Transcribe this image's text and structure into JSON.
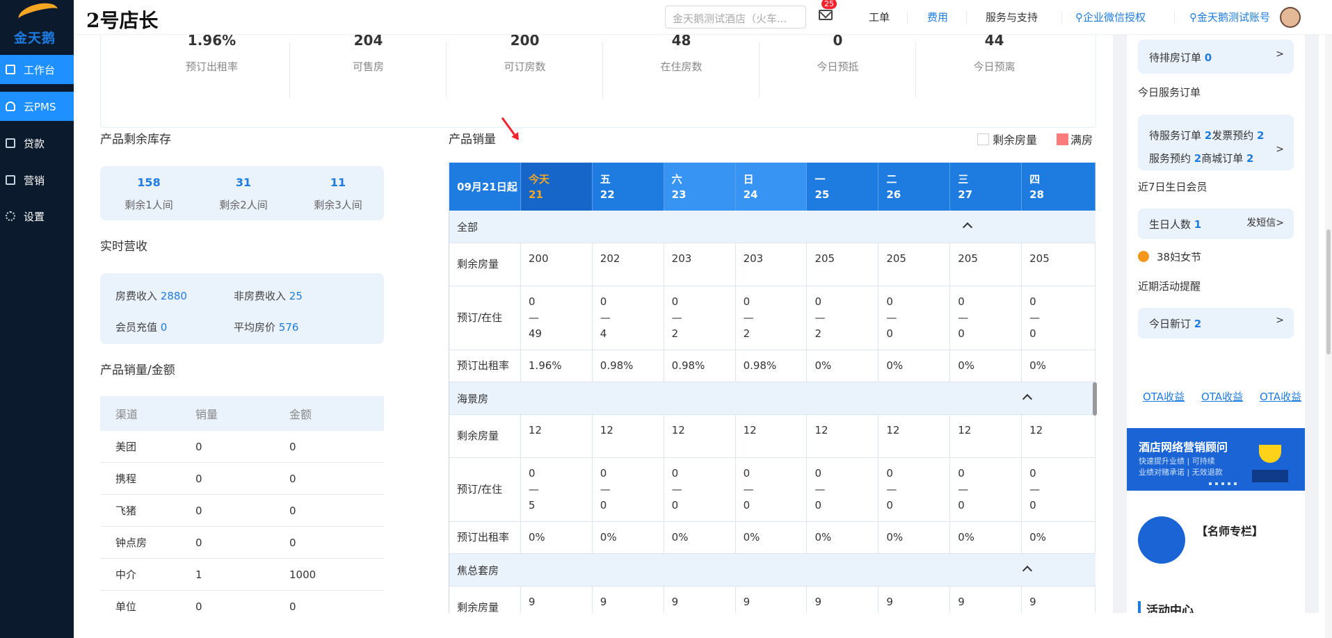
{
  "sidebar": {
    "logo_text": "金天鹅",
    "items": [
      {
        "label": "工作台",
        "icon": "workbench-icon"
      },
      {
        "label": "云PMS",
        "icon": "cloud-icon"
      },
      {
        "label": "贷款",
        "icon": "loan-icon"
      },
      {
        "label": "营销",
        "icon": "marketing-icon"
      },
      {
        "label": "设置",
        "icon": "gear-icon"
      }
    ]
  },
  "topbar": {
    "brand": "2号店长",
    "hotel_select": "金天鹅测试酒店（火车...",
    "mail_badge": "25",
    "links": [
      "工单",
      "费用",
      "服务与支持",
      "企业微信授权",
      "金天鹅测试账号"
    ]
  },
  "stats": [
    {
      "value": "1.96%",
      "label": "预订出租率"
    },
    {
      "value": "204",
      "label": "可售房"
    },
    {
      "value": "200",
      "label": "可订房数"
    },
    {
      "value": "48",
      "label": "在住房数"
    },
    {
      "value": "0",
      "label": "今日预抵"
    },
    {
      "value": "44",
      "label": "今日预离"
    }
  ],
  "inventory": {
    "title": "产品剩余库存",
    "items": [
      {
        "value": "158",
        "label": "剩余1人间"
      },
      {
        "value": "31",
        "label": "剩余2人间"
      },
      {
        "value": "11",
        "label": "剩余3人间"
      }
    ]
  },
  "revenue": {
    "title": "实时营收",
    "room_label": "房费收入",
    "room_value": "2880",
    "nonroom_label": "非房费收入",
    "nonroom_value": "25",
    "member_label": "会员充值",
    "member_value": "0",
    "avg_label": "平均房价",
    "avg_value": "576"
  },
  "sales_amount": {
    "title": "产品销量/金额",
    "headers": [
      "渠道",
      "销量",
      "金额"
    ],
    "rows": [
      [
        "美团",
        "0",
        "0"
      ],
      [
        "携程",
        "0",
        "0"
      ],
      [
        "飞猪",
        "0",
        "0"
      ],
      [
        "钟点房",
        "0",
        "0"
      ],
      [
        "中介",
        "1",
        "1000"
      ],
      [
        "单位",
        "0",
        "0"
      ]
    ]
  },
  "product_sales": {
    "title": "产品销量",
    "legend_remaining": "剩余房量",
    "legend_full": "满房",
    "legend_full_color": "#f97b7b",
    "header_first": "09月21日起",
    "days": [
      {
        "w": "今天",
        "d": "21"
      },
      {
        "w": "五",
        "d": "22"
      },
      {
        "w": "六",
        "d": "23"
      },
      {
        "w": "日",
        "d": "24"
      },
      {
        "w": "一",
        "d": "25"
      },
      {
        "w": "二",
        "d": "26"
      },
      {
        "w": "三",
        "d": "27"
      },
      {
        "w": "四",
        "d": "28"
      }
    ],
    "groups": [
      {
        "name": "全部",
        "remaining_label": "剩余房量",
        "remaining": [
          "200",
          "202",
          "203",
          "203",
          "205",
          "205",
          "205",
          "205"
        ],
        "booked_label": "预订/在住",
        "booked": [
          [
            "0",
            "—",
            "49"
          ],
          [
            "0",
            "—",
            "4"
          ],
          [
            "0",
            "—",
            "2"
          ],
          [
            "0",
            "—",
            "2"
          ],
          [
            "0",
            "—",
            "2"
          ],
          [
            "0",
            "—",
            "0"
          ],
          [
            "0",
            "—",
            "0"
          ],
          [
            "0",
            "—",
            "0"
          ]
        ],
        "rate_label": "预订出租率",
        "rate": [
          "1.96%",
          "0.98%",
          "0.98%",
          "0.98%",
          "0%",
          "0%",
          "0%",
          "0%"
        ]
      },
      {
        "name": "海景房",
        "remaining_label": "剩余房量",
        "remaining": [
          "12",
          "12",
          "12",
          "12",
          "12",
          "12",
          "12",
          "12"
        ],
        "booked_label": "预订/在住",
        "booked": [
          [
            "0",
            "—",
            "5"
          ],
          [
            "0",
            "—",
            "0"
          ],
          [
            "0",
            "—",
            "0"
          ],
          [
            "0",
            "—",
            "0"
          ],
          [
            "0",
            "—",
            "0"
          ],
          [
            "0",
            "—",
            "0"
          ],
          [
            "0",
            "—",
            "0"
          ],
          [
            "0",
            "—",
            "0"
          ]
        ],
        "rate_label": "预订出租率",
        "rate": [
          "0%",
          "0%",
          "0%",
          "0%",
          "0%",
          "0%",
          "0%",
          "0%"
        ]
      },
      {
        "name": "焦总套房",
        "remaining_label": "剩余房量",
        "remaining": [
          "9",
          "9",
          "9",
          "9",
          "9",
          "9",
          "9",
          "9"
        ]
      }
    ]
  },
  "right": {
    "pending_assign": "待排房订单",
    "pending_assign_count": "0",
    "service_title": "今日服务订单",
    "service_pending": "待服务订单",
    "service_pending_count": "2",
    "invoice": "发票预约",
    "invoice_count": "2",
    "service_booking": "服务预约",
    "service_booking_count": "2",
    "mall": "商城订单",
    "mall_count": "2",
    "birthday_title": "近7日生日会员",
    "birthday_label": "生日人数",
    "birthday_count": "1",
    "sms": "发短信>",
    "festival": "38妇女节",
    "activity_title": "近期活动提醒",
    "new_orders": "今日新订",
    "new_orders_count": "2",
    "ota": [
      "OTA收益",
      "OTA收益",
      "OTA收益"
    ],
    "banner_title": "酒店网络营销顾问",
    "banner_line1": "快速提升业绩 | 可持续",
    "banner_line2": "业绩对赌承诺 | 无效退款",
    "mingshi": "【名师专栏】",
    "activity_center": "活动中心"
  }
}
